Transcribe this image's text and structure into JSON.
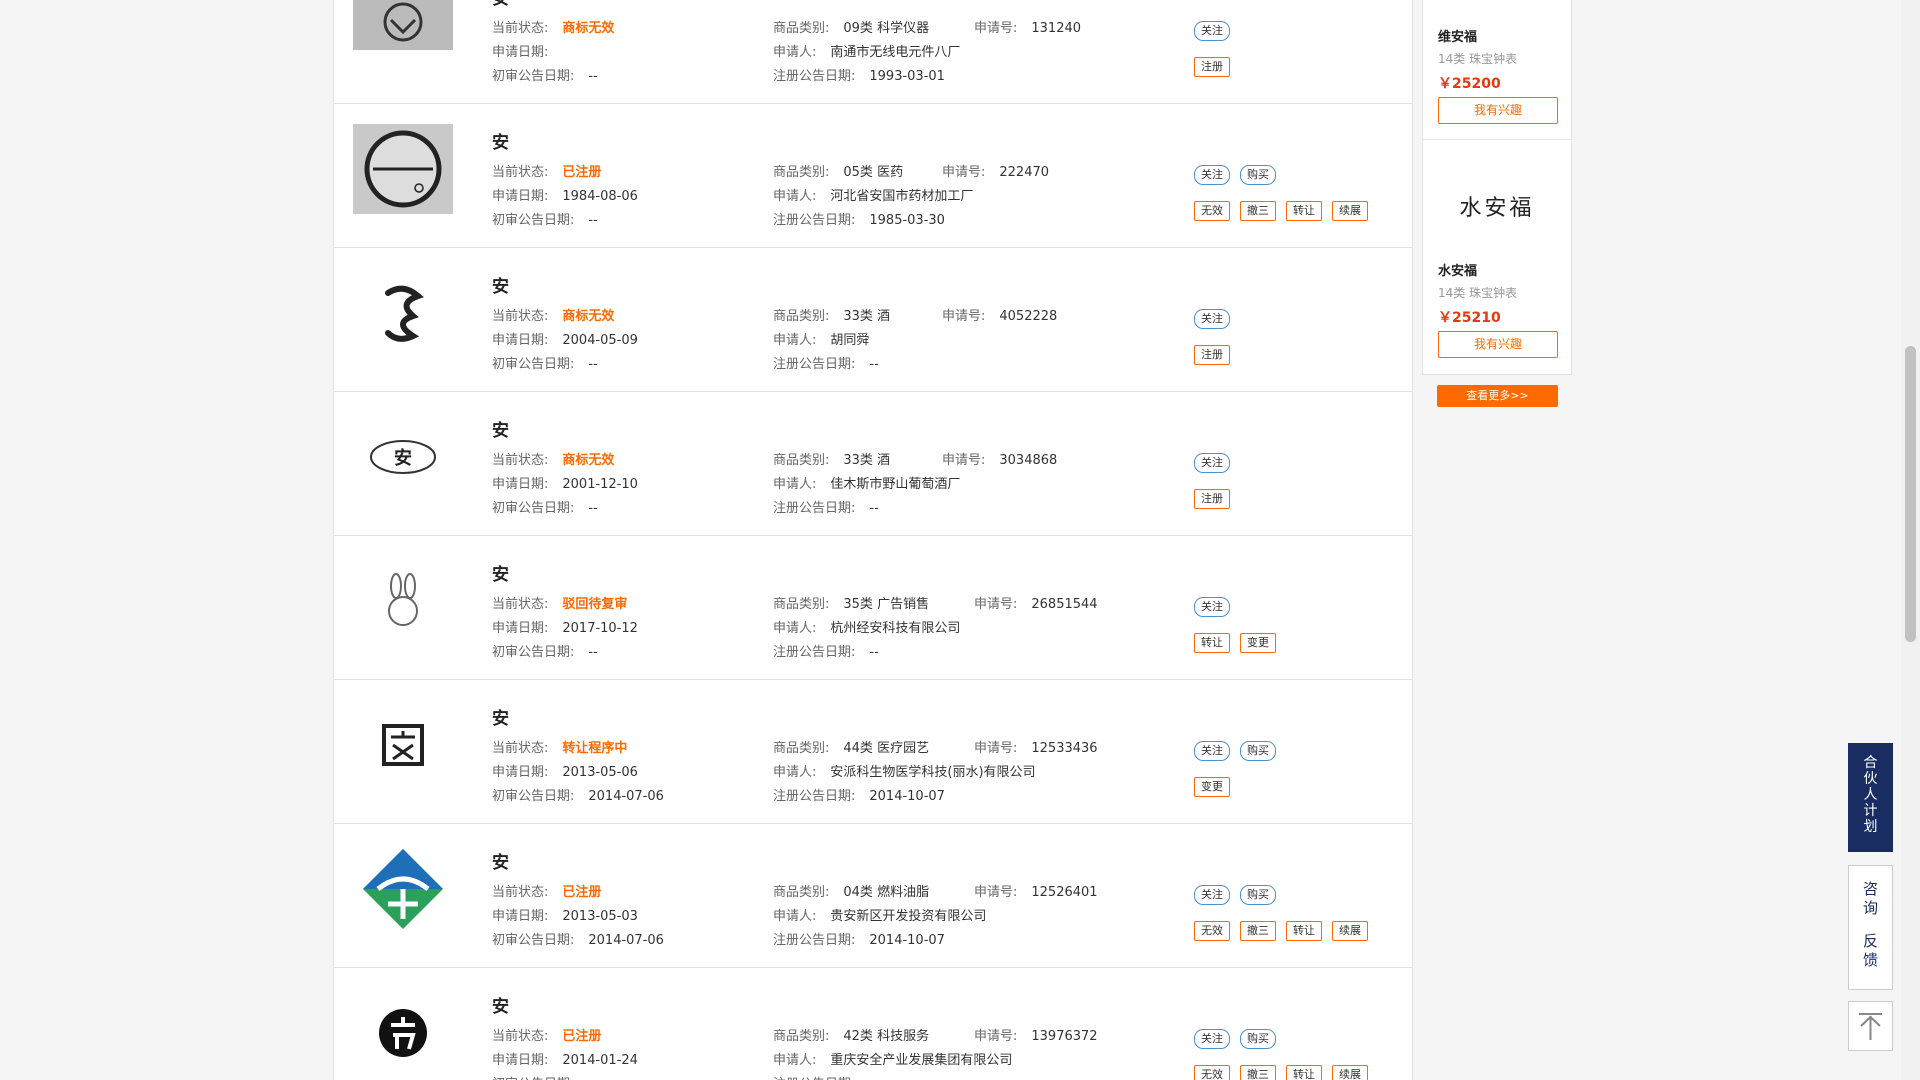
{
  "labels": {
    "status": "当前状态:",
    "apply_date": "申请日期:",
    "prelim": "初审公告日期:",
    "category": "商品类别:",
    "applicant": "申请人:",
    "reg_no": "申请号:",
    "reg_date": "注册公告日期:"
  },
  "rows": [
    {
      "title": "安",
      "status": "商标无效",
      "apply_date": "",
      "prelim": "--",
      "category": "09类 科学仪器",
      "applicant": "南通市无线电元件八厂",
      "reg_no": "131240",
      "reg_date": "1993-03-01",
      "buttons_top": [
        "关注"
      ],
      "buttons_bottom": [
        "注册"
      ]
    },
    {
      "title": "安",
      "status": "已注册",
      "apply_date": "1984-08-06",
      "prelim": "--",
      "category": "05类 医药",
      "applicant": "河北省安国市药材加工厂",
      "reg_no": "222470",
      "reg_date": "1985-03-30",
      "buttons_top": [
        "关注",
        "购买"
      ],
      "buttons_bottom": [
        "无效",
        "撤三",
        "转让",
        "续展"
      ]
    },
    {
      "title": "安",
      "status": "商标无效",
      "apply_date": "2004-05-09",
      "prelim": "--",
      "category": "33类 酒",
      "applicant": "胡同舜",
      "reg_no": "4052228",
      "reg_date": "--",
      "buttons_top": [
        "关注"
      ],
      "buttons_bottom": [
        "注册"
      ]
    },
    {
      "title": "安",
      "status": "商标无效",
      "apply_date": "2001-12-10",
      "prelim": "--",
      "category": "33类 酒",
      "applicant": "佳木斯市野山葡萄酒厂",
      "reg_no": "3034868",
      "reg_date": "--",
      "buttons_top": [
        "关注"
      ],
      "buttons_bottom": [
        "注册"
      ]
    },
    {
      "title": "安",
      "status": "驳回待复审",
      "apply_date": "2017-10-12",
      "prelim": "--",
      "category": "35类 广告销售",
      "applicant": "杭州经安科技有限公司",
      "reg_no": "26851544",
      "reg_date": "--",
      "buttons_top": [
        "关注"
      ],
      "buttons_bottom": [
        "转让",
        "变更"
      ]
    },
    {
      "title": "安",
      "status": "转让程序中",
      "apply_date": "2013-05-06",
      "prelim": "2014-07-06",
      "category": "44类 医疗园艺",
      "applicant": "安派科生物医学科技(丽水)有限公司",
      "reg_no": "12533436",
      "reg_date": "2014-10-07",
      "buttons_top": [
        "关注",
        "购买"
      ],
      "buttons_bottom": [
        "变更"
      ]
    },
    {
      "title": "安",
      "status": "已注册",
      "apply_date": "2013-05-03",
      "prelim": "2014-07-06",
      "category": "04类 燃料油脂",
      "applicant": "贵安新区开发投资有限公司",
      "reg_no": "12526401",
      "reg_date": "2014-10-07",
      "buttons_top": [
        "关注",
        "购买"
      ],
      "buttons_bottom": [
        "无效",
        "撤三",
        "转让",
        "续展"
      ]
    },
    {
      "title": "安",
      "status": "已注册",
      "apply_date": "2014-01-24",
      "prelim": "",
      "category": "42类 科技服务",
      "applicant": "重庆安全产业发展集团有限公司",
      "reg_no": "13976372",
      "reg_date": "",
      "buttons_top": [
        "关注",
        "购买"
      ],
      "buttons_bottom": [
        "无效",
        "撤三",
        "转让",
        "续展"
      ]
    }
  ],
  "side_cards": [
    {
      "logo_text": "",
      "name": "维安福",
      "category": "14类 珠宝钟表",
      "price": "￥25200",
      "button": "我有兴趣"
    },
    {
      "logo_text": "水安福",
      "name": "水安福",
      "category": "14类 珠宝钟表",
      "price": "￥25210",
      "button": "我有兴趣"
    }
  ],
  "see_more": "查看更多>>",
  "float": {
    "partner": [
      "合",
      "伙",
      "人",
      "计",
      "划"
    ],
    "feedback": [
      "咨",
      "询",
      "反",
      "馈"
    ]
  },
  "colors": {
    "accent": "#ff6a00",
    "navy": "#1a2d63",
    "price": "#e8380d"
  }
}
